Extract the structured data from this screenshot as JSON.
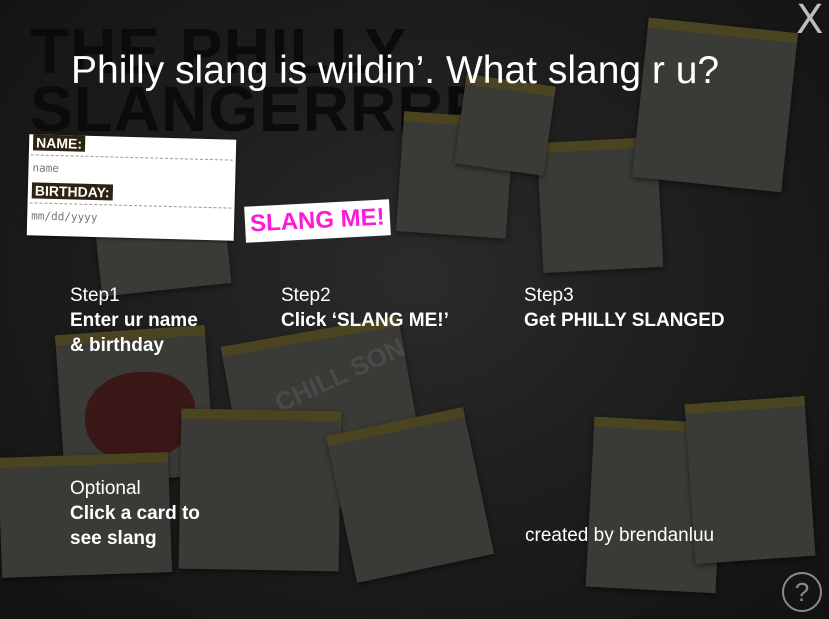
{
  "background": {
    "title_line1": "THE PHILLY",
    "title_line2": "SLANGERRRR",
    "card_text_1": "CHILL SON"
  },
  "header": {
    "close_label": "X",
    "headline": "Philly slang is wildin’. What slang r u?"
  },
  "form": {
    "name_label": "NAME:",
    "name_placeholder": "name",
    "birthday_label": "BIRTHDAY:",
    "birthday_placeholder": "mm/dd/yyyy"
  },
  "slang_button": "SLANG ME!",
  "steps": [
    {
      "head": "Step1",
      "line1": "Enter ur name",
      "line2": "& birthday"
    },
    {
      "head": "Step2",
      "line1": "Click ‘SLANG ME!’",
      "line2": ""
    },
    {
      "head": "Step3",
      "line1": "Get PHILLY SLANGED",
      "line2": ""
    }
  ],
  "optional": {
    "head": "Optional",
    "line1": "Click a card to",
    "line2": "see slang"
  },
  "credit": "created by brendanluu",
  "help_label": "?",
  "colors": {
    "accent": "#ff19d9",
    "text": "#ffffff"
  }
}
